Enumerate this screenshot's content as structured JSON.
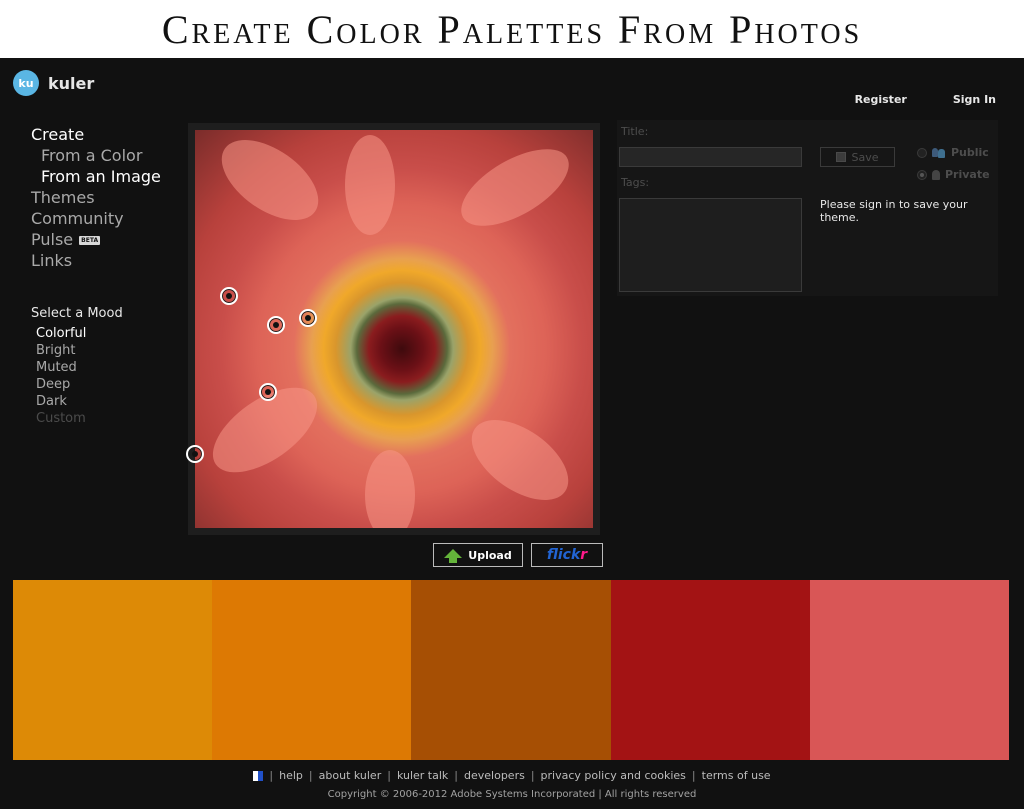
{
  "banner": {
    "title": "Create Color Palettes From Photos"
  },
  "app": {
    "logo_badge": "ku",
    "logo_text": "kuler"
  },
  "header": {
    "register": "Register",
    "sign_in": "Sign In"
  },
  "nav": {
    "create": "Create",
    "from_color": "From a Color",
    "from_image": "From an Image",
    "themes": "Themes",
    "community": "Community",
    "pulse": "Pulse",
    "pulse_badge": "BETA",
    "links": "Links"
  },
  "mood": {
    "heading": "Select a Mood",
    "items": [
      "Colorful",
      "Bright",
      "Muted",
      "Deep",
      "Dark",
      "Custom"
    ],
    "selected": "Colorful"
  },
  "image_actions": {
    "upload": "Upload",
    "flickr_a": "flick",
    "flickr_b": "r"
  },
  "form": {
    "title_label": "Title:",
    "title_value": "",
    "tags_label": "Tags:",
    "tags_value": "",
    "save": "Save",
    "public": "Public",
    "private": "Private",
    "signin_message": "Please sign in to save your theme."
  },
  "palette": {
    "colors": [
      "#dd8a06",
      "#dd7903",
      "#a64f04",
      "#a31314",
      "#d95656"
    ]
  },
  "footer": {
    "links": [
      "help",
      "about kuler",
      "kuler talk",
      "developers",
      "privacy policy and cookies",
      "terms of use"
    ],
    "copyright": "Copyright © 2006-2012 Adobe Systems Incorporated | All rights reserved"
  }
}
